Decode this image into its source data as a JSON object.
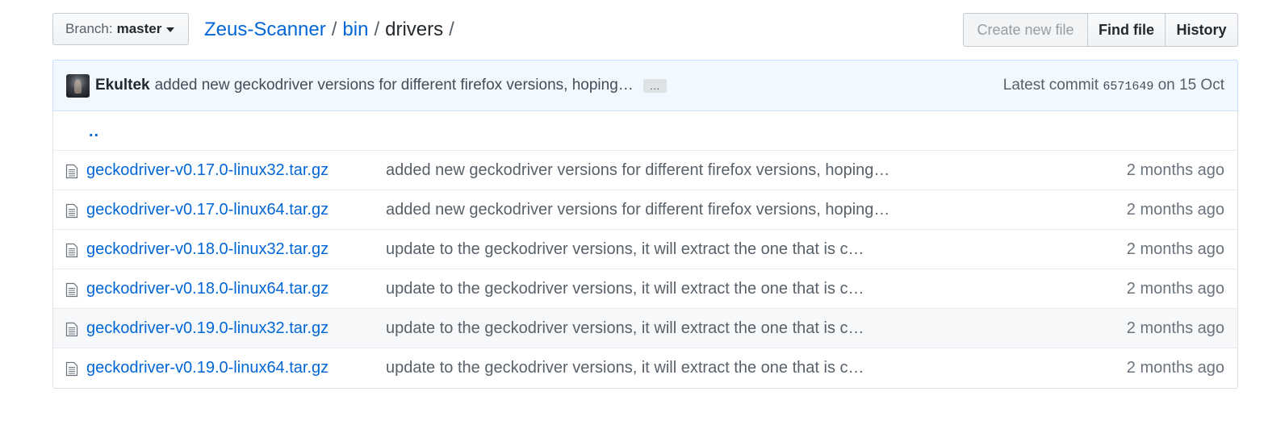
{
  "branch": {
    "prefix": "Branch:",
    "name": "master"
  },
  "breadcrumb": {
    "repo": "Zeus-Scanner",
    "dir": "bin",
    "current": "drivers",
    "sep": "/"
  },
  "actions": {
    "create": "Create new file",
    "find": "Find file",
    "history": "History"
  },
  "commit": {
    "author": "Ekultek",
    "message": "added new geckodriver versions for different firefox versions, hoping…",
    "ellipsis": "…",
    "latest_label": "Latest commit",
    "sha": "6571649",
    "on_label": "on 15 Oct"
  },
  "parent_dir": "..",
  "files": [
    {
      "name": "geckodriver-v0.17.0-linux32.tar.gz",
      "message": "added new geckodriver versions for different firefox versions, hoping…",
      "age": "2 months ago"
    },
    {
      "name": "geckodriver-v0.17.0-linux64.tar.gz",
      "message": "added new geckodriver versions for different firefox versions, hoping…",
      "age": "2 months ago"
    },
    {
      "name": "geckodriver-v0.18.0-linux32.tar.gz",
      "message": "update to the geckodriver versions, it will extract the one that is c…",
      "age": "2 months ago"
    },
    {
      "name": "geckodriver-v0.18.0-linux64.tar.gz",
      "message": "update to the geckodriver versions, it will extract the one that is c…",
      "age": "2 months ago"
    },
    {
      "name": "geckodriver-v0.19.0-linux32.tar.gz",
      "message": "update to the geckodriver versions, it will extract the one that is c…",
      "age": "2 months ago"
    },
    {
      "name": "geckodriver-v0.19.0-linux64.tar.gz",
      "message": "update to the geckodriver versions, it will extract the one that is c…",
      "age": "2 months ago"
    }
  ],
  "icons": {
    "file": "file-icon",
    "caret": "caret-down-icon"
  }
}
